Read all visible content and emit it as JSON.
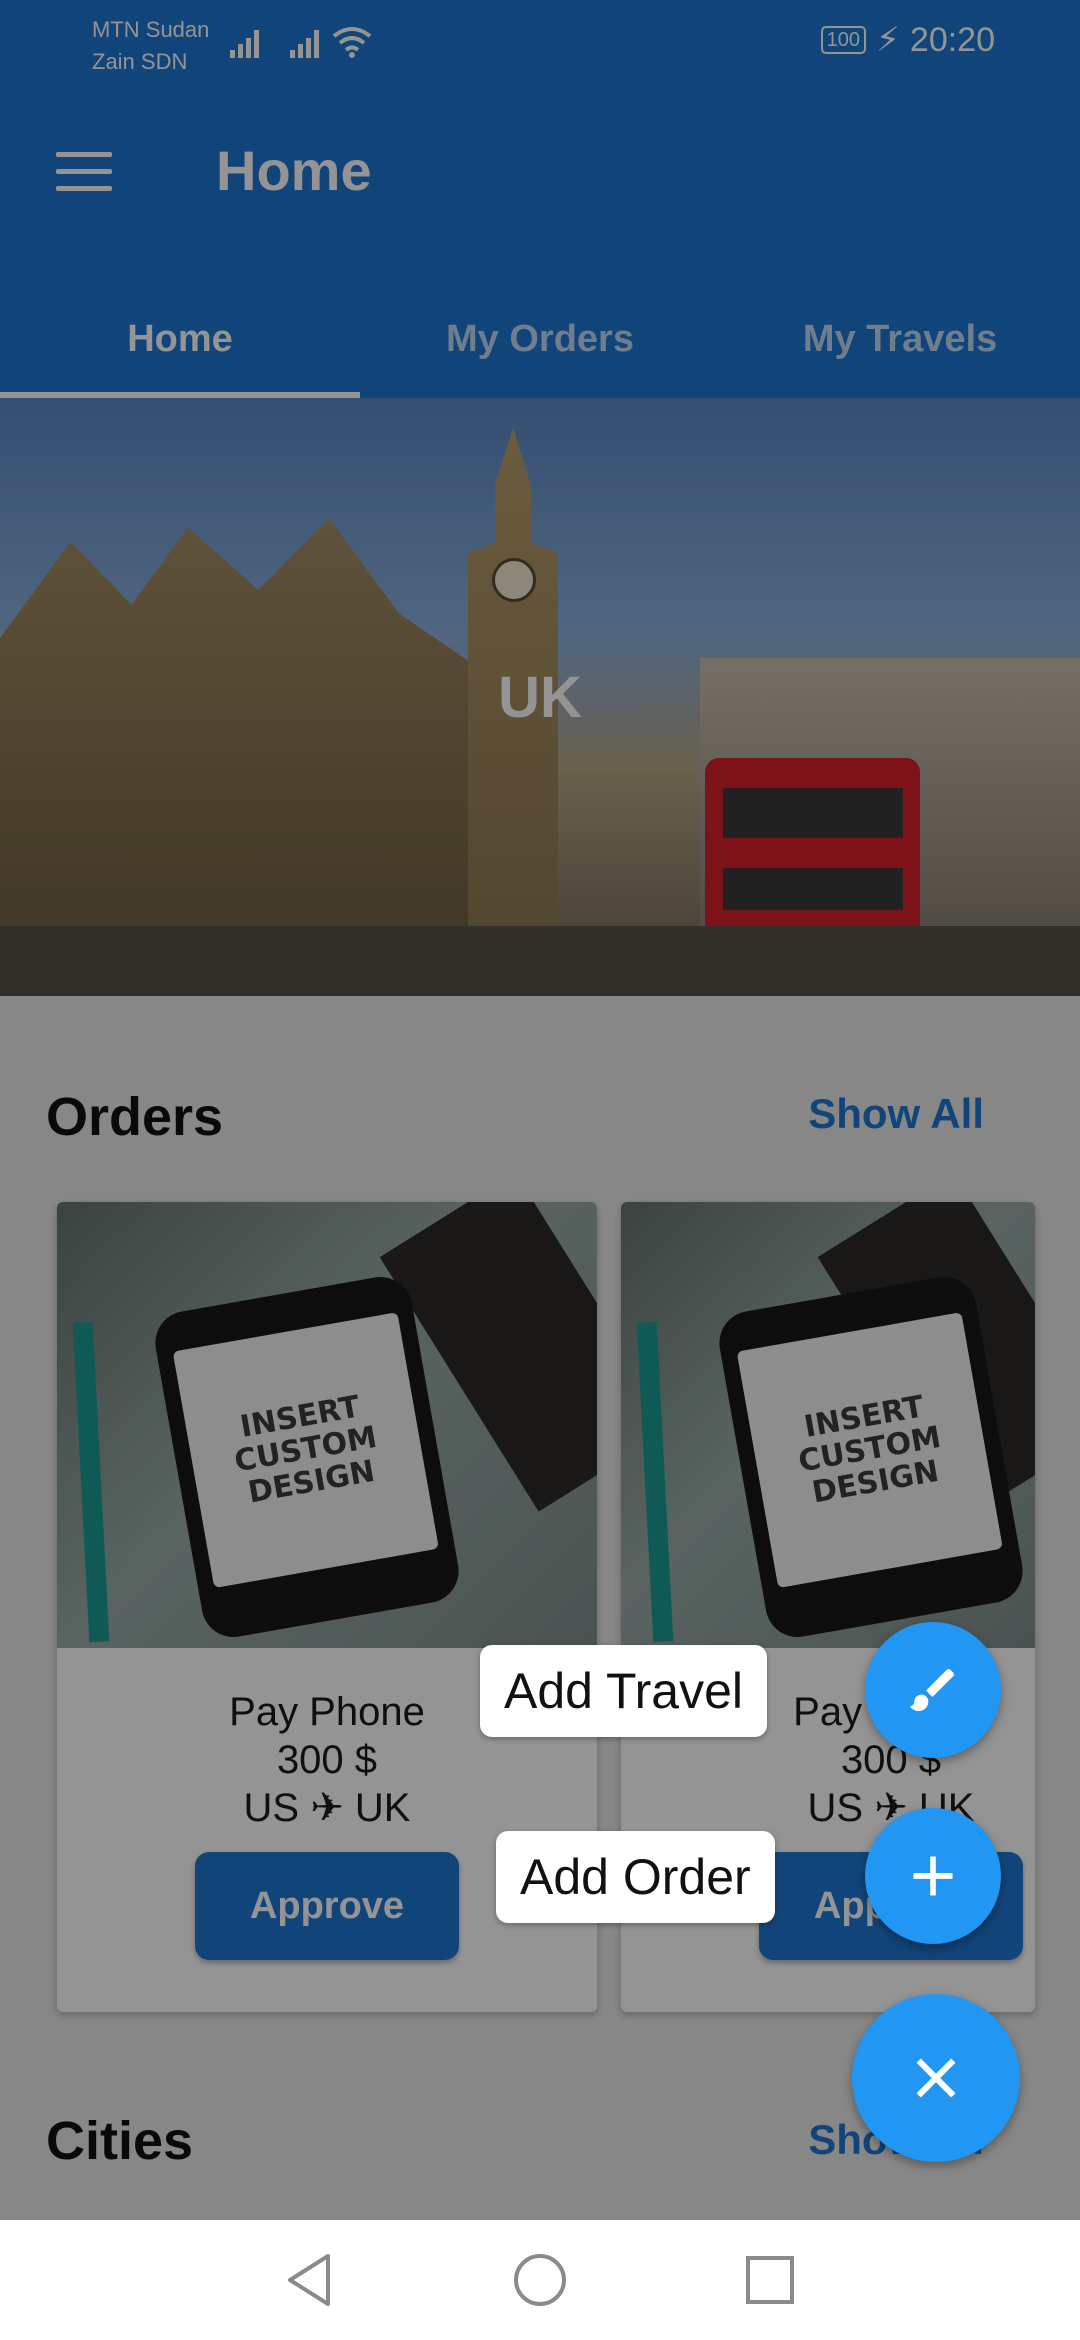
{
  "status_bar": {
    "carrier_1": "MTN Sudan",
    "carrier_2": "Zain SDN",
    "battery": "100",
    "time": "20:20"
  },
  "app_bar": {
    "menu_icon": "hamburger-menu-icon",
    "title": "Home"
  },
  "tabs": [
    {
      "label": "Home",
      "active": true
    },
    {
      "label": "My Orders",
      "active": false
    },
    {
      "label": "My Travels",
      "active": false
    }
  ],
  "hero": {
    "label": "UK"
  },
  "orders": {
    "title": "Orders",
    "show_all": "Show All",
    "cards": [
      {
        "image_text": "INSERT CUSTOM DESIGN",
        "name": "Pay Phone",
        "price": "300 $",
        "from": "US",
        "to": "UK",
        "button": "Approve"
      },
      {
        "image_text": "INSERT CUSTOM DESIGN",
        "name": "Pay Phone",
        "price": "300 $",
        "from": "US",
        "to": "UK",
        "button": "Approve"
      }
    ]
  },
  "cities": {
    "title": "Cities",
    "show_all": "Show All"
  },
  "speed_dial": {
    "add_travel_label": "Add Travel",
    "add_travel_icon": "brush-icon",
    "add_order_label": "Add Order",
    "add_order_icon": "plus-icon",
    "close_icon": "close-icon",
    "accent_color": "#2196f3"
  },
  "nav_bar": {
    "back_icon": "back-triangle-icon",
    "home_icon": "home-circle-icon",
    "recents_icon": "recents-square-icon"
  }
}
